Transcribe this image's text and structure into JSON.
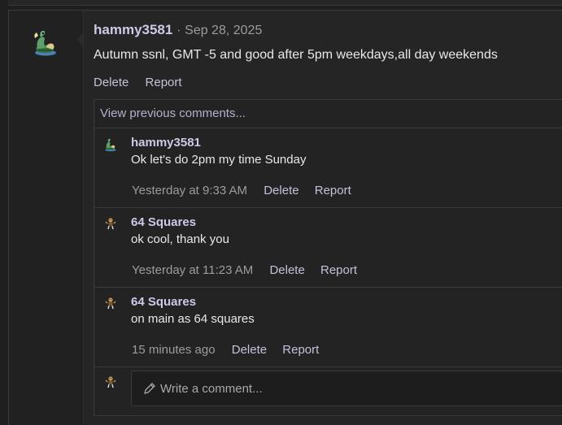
{
  "post": {
    "author": "hammy3581",
    "separator": "·",
    "date": "Sep 28, 2025",
    "text": "Autumn ssnl, GMT -5 and good after 5pm weekdays,all day weekends",
    "delete_label": "Delete",
    "report_label": "Report",
    "avatar_icon": "pokemon-avatar-icon"
  },
  "comments_section": {
    "view_previous_label": "View previous comments...",
    "items": [
      {
        "author": "hammy3581",
        "text": "Ok let's do 2pm my time Sunday",
        "time": "Yesterday at 9:33 AM",
        "delete_label": "Delete",
        "report_label": "Report"
      },
      {
        "author": "64 Squares",
        "text": "ok cool, thank you",
        "time": "Yesterday at 11:23 AM",
        "delete_label": "Delete",
        "report_label": "Report"
      },
      {
        "author": "64 Squares",
        "text": "on main as 64 squares",
        "time": "15 minutes ago",
        "delete_label": "Delete",
        "report_label": "Report"
      }
    ],
    "write_placeholder": "Write a comment..."
  },
  "colors": {
    "background": "#1f1f1f",
    "panel": "#252525",
    "username": "#cfc8e6",
    "link": "#c6c1d9",
    "muted": "#9c9c9c",
    "border": "#3a3a3a"
  }
}
